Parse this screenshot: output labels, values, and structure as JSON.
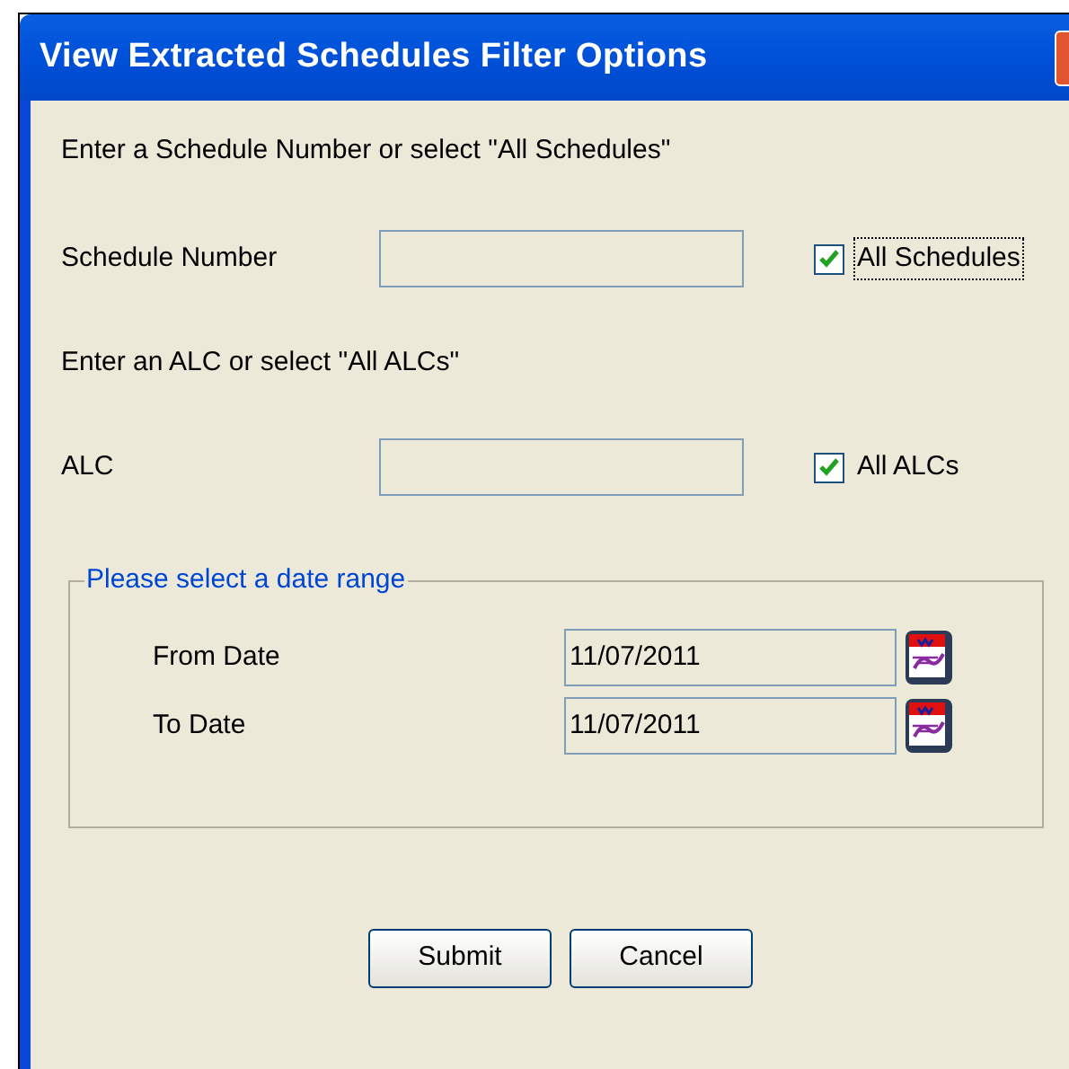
{
  "window": {
    "title": "View Extracted Schedules Filter Options"
  },
  "schedule": {
    "prompt": "Enter a Schedule Number or select \"All Schedules\"",
    "label": "Schedule Number",
    "checkbox": {
      "label": "All Schedules",
      "checked": true,
      "focused": true
    }
  },
  "alc": {
    "prompt": "Enter an ALC or select \"All ALCs\"",
    "label": "ALC",
    "checkbox": {
      "label": "All ALCs",
      "checked": true,
      "focused": false
    }
  },
  "date_range": {
    "title": "Please select a date range",
    "rows": [
      {
        "label": "From Date",
        "value": "11/07/2011"
      },
      {
        "label": "To Date",
        "value": "11/07/2011"
      }
    ]
  },
  "buttons": [
    {
      "label": "Submit"
    },
    {
      "label": "Cancel"
    }
  ]
}
